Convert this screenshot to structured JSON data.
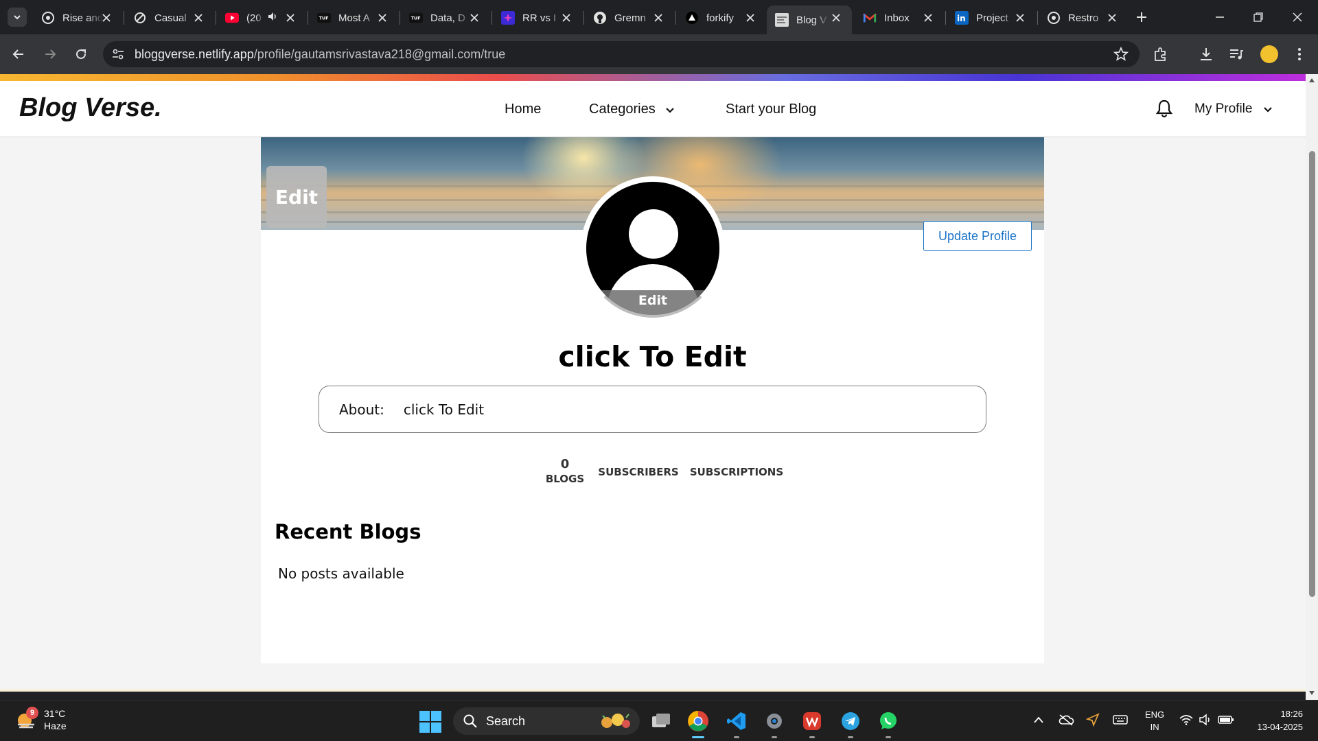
{
  "browser": {
    "tabs": [
      {
        "title": "Rise and",
        "favicon": "openai-icon"
      },
      {
        "title": "Casual",
        "favicon": "link-icon"
      },
      {
        "title": "(20",
        "favicon": "youtube-icon"
      },
      {
        "title": "Most A",
        "favicon": "tuf-icon"
      },
      {
        "title": "Data, D",
        "favicon": "tuf-icon"
      },
      {
        "title": "RR vs I",
        "favicon": "cricket-icon"
      },
      {
        "title": "Gremn",
        "favicon": "github-icon"
      },
      {
        "title": "forkify",
        "favicon": "vercel-icon"
      },
      {
        "title": "Blog V",
        "favicon": "blog-icon",
        "active": true
      },
      {
        "title": "Inbox",
        "favicon": "gmail-icon"
      },
      {
        "title": "Project",
        "favicon": "linkedin-icon"
      },
      {
        "title": "Restro",
        "favicon": "openai-icon"
      }
    ],
    "url_host": "bloggverse.netlify.app",
    "url_path": "/profile/gautamsrivastava218@gmail.com/true"
  },
  "site": {
    "logo": "Blog Verse.",
    "nav": {
      "home": "Home",
      "categories": "Categories",
      "start_blog": "Start your Blog",
      "my_profile": "My Profile"
    }
  },
  "profile": {
    "banner_edit": "Edit",
    "avatar_edit": "Edit",
    "update_button": "Update Profile",
    "name": "click To Edit",
    "about_label": "About:",
    "about_value": "click To Edit",
    "stats": {
      "blogs_count": "0",
      "blogs_label": "BLOGS",
      "subscribers_label": "SUBSCRIBERS",
      "subscriptions_label": "SUBSCRIPTIONS"
    },
    "recent_title": "Recent Blogs",
    "no_posts": "No posts available"
  },
  "taskbar": {
    "weather_temp": "31°C",
    "weather_desc": "Haze",
    "weather_badge": "9",
    "search_label": "Search",
    "lang_1": "ENG",
    "lang_2": "IN",
    "time": "18:26",
    "date": "13-04-2025"
  },
  "colors": {
    "accent_link": "#1a73c8",
    "browser_dark": "#202124",
    "browser_toolbar": "#35363a"
  }
}
